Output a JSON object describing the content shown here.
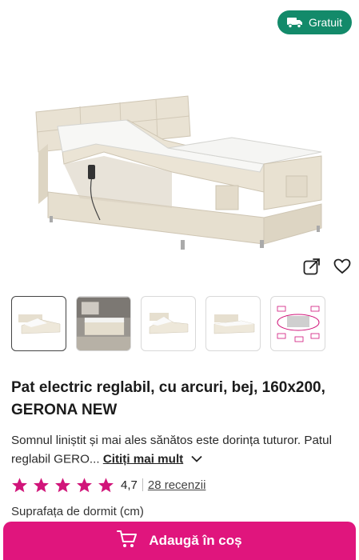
{
  "badge": {
    "label": "Gratuit",
    "icon": "truck-icon",
    "color": "#138a6a"
  },
  "product": {
    "title": "Pat electric reglabil, cu arcuri, bej, 160x200, GERONA NEW",
    "description": "Somnul liniștit și mai ales sănătos este dorința tuturor. Patul reglabil GERO...",
    "read_more": "Citiți mai mult",
    "rating": {
      "score": "4,7",
      "stars": 5,
      "reviews": "28 recenzii",
      "star_color": "#d1157a"
    },
    "sleeping_surface_label": "Suprafața de dormit (cm)"
  },
  "actions": {
    "share_icon": "share-icon",
    "favorite_icon": "heart-icon"
  },
  "gallery": {
    "thumbnails": [
      {
        "name": "thumb-bed-main",
        "active": true
      },
      {
        "name": "thumb-bed-room",
        "active": false
      },
      {
        "name": "thumb-bed-raised",
        "active": false
      },
      {
        "name": "thumb-bed-flat",
        "active": false
      },
      {
        "name": "thumb-bed-diagram",
        "active": false
      }
    ]
  },
  "cart": {
    "label": "Adaugă în coș",
    "icon": "cart-icon",
    "color": "#e0157d"
  }
}
